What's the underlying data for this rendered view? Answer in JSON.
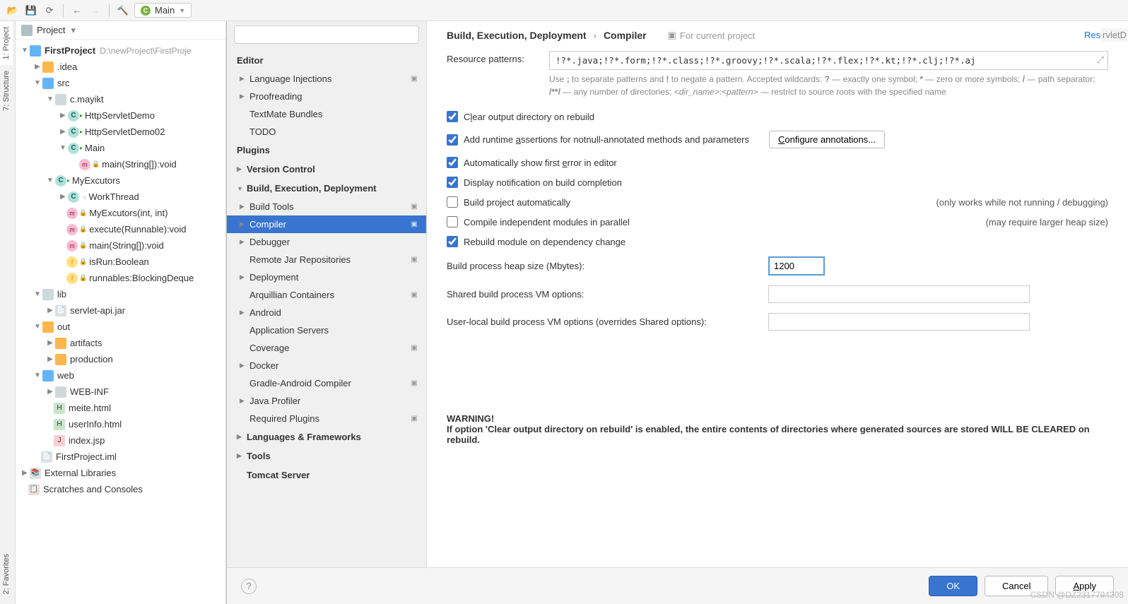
{
  "toolbar": {
    "run_config": "Main"
  },
  "left_tabs": [
    "1: Project",
    "7: Structure",
    "2: Favorites"
  ],
  "project_panel": {
    "title": "Project"
  },
  "tree": {
    "root": "FirstProject",
    "root_path": "D:\\newProject\\FirstProje",
    "idea": ".idea",
    "src": "src",
    "pkg": "c.mayikt",
    "cls1": "HttpServletDemo",
    "cls2": "HttpServletDemo02",
    "cls3": "Main",
    "m1": "main(String[]):void",
    "cls4": "MyExcutors",
    "cls5": "WorkThread",
    "m2": "MyExcutors(int, int)",
    "m3": "execute(Runnable):void",
    "m4": "main(String[]):void",
    "f1": "isRun:Boolean",
    "f2": "runnables:BlockingDeque",
    "lib": "lib",
    "jar": "servlet-api.jar",
    "out": "out",
    "art": "artifacts",
    "prod": "production",
    "web": "web",
    "webinf": "WEB-INF",
    "html1": "meite.html",
    "html2": "userInfo.html",
    "jsp": "index.jsp",
    "iml": "FirstProject.iml",
    "extlib": "External Libraries",
    "scratch": "Scratches and Consoles"
  },
  "settings_search_placeholder": "",
  "settings_tree": {
    "editor": "Editor",
    "lang_inj": "Language Injections",
    "proof": "Proofreading",
    "textmate": "TextMate Bundles",
    "todo": "TODO",
    "plugins": "Plugins",
    "version": "Version Control",
    "build": "Build, Execution, Deployment",
    "build_tools": "Build Tools",
    "compiler": "Compiler",
    "debugger": "Debugger",
    "remote_jar": "Remote Jar Repositories",
    "deployment": "Deployment",
    "arq": "Arquillian Containers",
    "android": "Android",
    "appsrv": "Application Servers",
    "coverage": "Coverage",
    "docker": "Docker",
    "gradle_android": "Gradle-Android Compiler",
    "java_profiler": "Java Profiler",
    "req_plugins": "Required Plugins",
    "lang_fw": "Languages & Frameworks",
    "tools": "Tools",
    "tomcat": "Tomcat Server"
  },
  "content": {
    "crumb1": "Build, Execution, Deployment",
    "crumb2": "Compiler",
    "for_proj": "For current project",
    "reset": "Reset",
    "res_patterns_label": "Resource patterns:",
    "res_patterns_value": "!?*.java;!?*.form;!?*.class;!?*.groovy;!?*.scala;!?*.flex;!?*.kt;!?*.clj;!?*.aj",
    "hint": "Use ; to separate patterns and ! to negate a pattern. Accepted wildcards: ? — exactly one symbol; * — zero or more symbols; / — path separator; /**/ — any number of directories; <dir_name>:<pattern> — restrict to source roots with the specified name",
    "chk_clear": "Clear output directory on rebuild",
    "chk_assert": "Add runtime assertions for notnull-annotated methods and parameters",
    "btn_conf_ann": "Configure annotations...",
    "chk_auto_err": "Automatically show first error in editor",
    "chk_notif": "Display notification on build completion",
    "chk_build_auto": "Build project automatically",
    "side_build_auto": "(only works while not running / debugging)",
    "chk_parallel": "Compile independent modules in parallel",
    "side_parallel": "(may require larger heap size)",
    "chk_rebuild": "Rebuild module on dependency change",
    "heap_label": "Build process heap size (Mbytes):",
    "heap_value": "1200",
    "shared_vm_label": "Shared build process VM options:",
    "user_vm_label": "User-local build process VM options (overrides Shared options):",
    "warn_title": "WARNING!",
    "warn_body": "If option 'Clear output directory on rebuild' is enabled, the entire contents of directories where generated sources are stored WILL BE CLEARED on rebuild."
  },
  "footer": {
    "ok": "OK",
    "cancel": "Cancel",
    "apply": "Apply"
  },
  "truncated": "rvletD",
  "watermark": "CSDN @DZ2317794308"
}
